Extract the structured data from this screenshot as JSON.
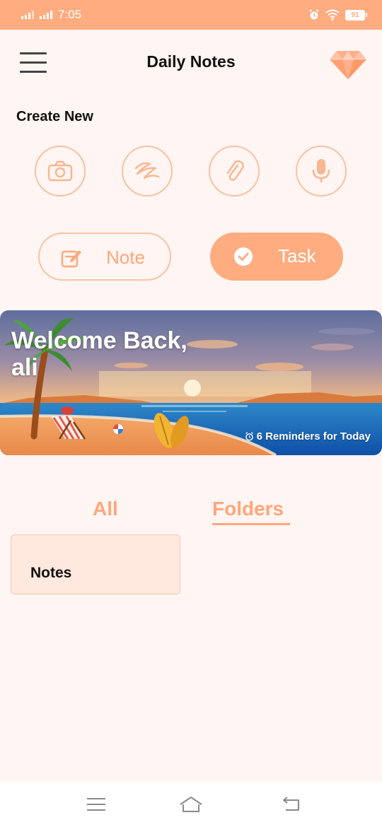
{
  "status_bar": {
    "time": "7:05",
    "battery": "91"
  },
  "app_bar": {
    "title": "Daily Notes"
  },
  "create_section": {
    "title": "Create New",
    "quick_actions": [
      "camera-icon",
      "scribble-icon",
      "paperclip-icon",
      "microphone-icon"
    ]
  },
  "actions": {
    "note_label": "Note",
    "task_label": "Task"
  },
  "banner": {
    "greeting": "Welcome Back,",
    "user_name": "ali",
    "reminders": "6 Reminders for Today"
  },
  "tabs": {
    "all": "All",
    "folders": "Folders",
    "selected": "Folders"
  },
  "folders": [
    {
      "name": "Notes"
    }
  ],
  "colors": {
    "accent": "#FFAC80",
    "accent_text": "#FFA77C",
    "outline": "#F9C2A4",
    "background": "#FFF5F2",
    "card": "#FFE9DE"
  }
}
